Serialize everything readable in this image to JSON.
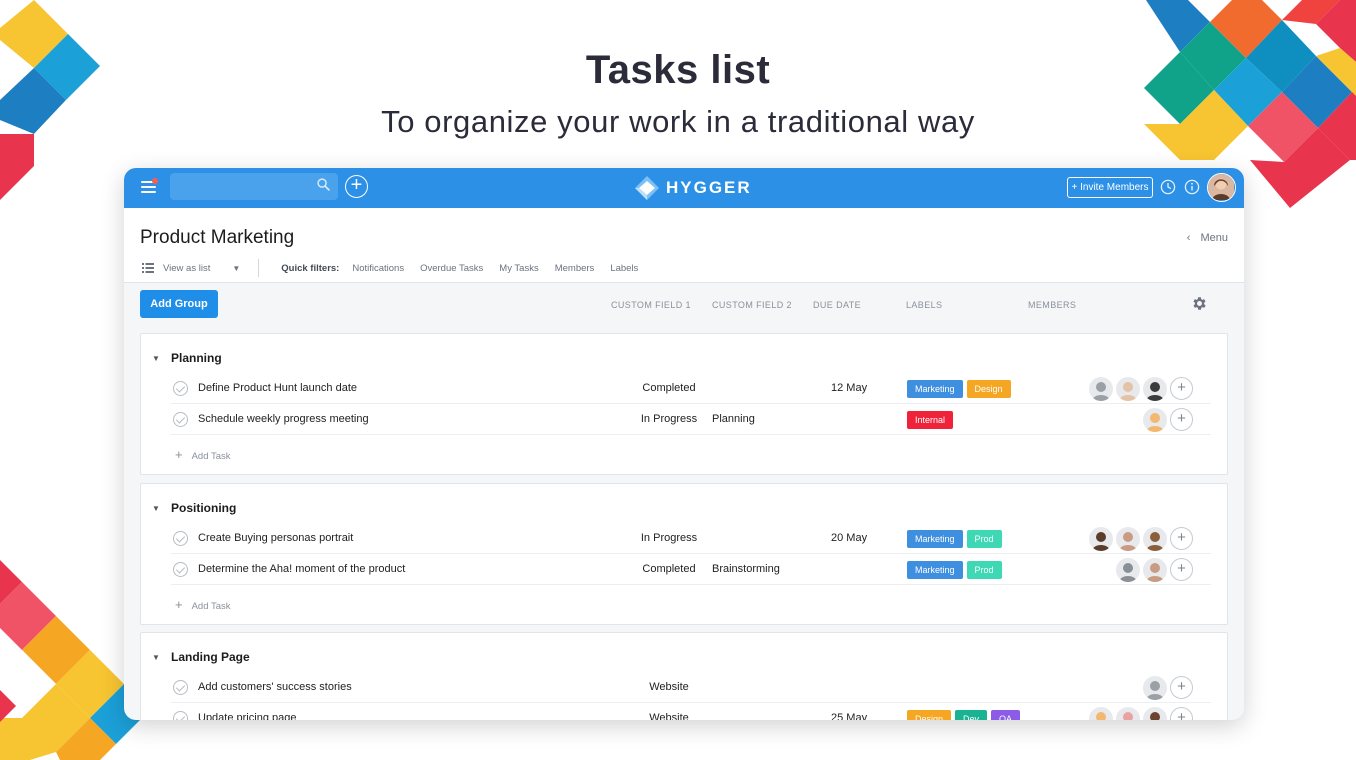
{
  "hero": {
    "title": "Tasks list",
    "subtitle": "To organize your work in a traditional way"
  },
  "topbar": {
    "logo": "HYGGER",
    "invite_label": "+ Invite Members",
    "icons": [
      "hamburger-icon",
      "search-icon",
      "plus-circle-icon",
      "clock-icon",
      "info-icon"
    ],
    "accent": "#2b90e6"
  },
  "header": {
    "title": "Product Marketing",
    "menu_label": "Menu",
    "view_label": "View as list",
    "quick_filters_label": "Quick filters:",
    "quick_filters": [
      "Notifications",
      "Overdue Tasks",
      "My Tasks",
      "Members",
      "Labels"
    ]
  },
  "toolbar": {
    "add_group_label": "Add Group",
    "columns": [
      "CUSTOM FIELD 1",
      "CUSTOM FIELD 2",
      "DUE DATE",
      "LABELS",
      "MEMBERS"
    ]
  },
  "label_colors": {
    "Marketing": "#3f8fe0",
    "Design": "#f5a623",
    "Internal": "#f0223a",
    "Prod": "#3ed9b4",
    "Dev": "#19b394",
    "QA": "#8c5ce6"
  },
  "add_task_label": "Add Task",
  "groups": [
    {
      "title": "Planning",
      "tasks": [
        {
          "name": "Define Product Hunt launch date",
          "cf1": "Completed",
          "cf2": "",
          "due": "12 May",
          "labels": [
            "Marketing",
            "Design"
          ],
          "members": 3
        },
        {
          "name": "Schedule weekly progress meeting",
          "cf1": "In Progress",
          "cf2": "Planning",
          "due": "",
          "labels": [
            "Internal"
          ],
          "members": 1
        }
      ]
    },
    {
      "title": "Positioning",
      "tasks": [
        {
          "name": "Create Buying personas portrait",
          "cf1": "In Progress",
          "cf2": "",
          "due": "20 May",
          "labels": [
            "Marketing",
            "Prod"
          ],
          "members": 3
        },
        {
          "name": "Determine the Aha! moment of the product",
          "cf1": "Completed",
          "cf2": "Brainstorming",
          "due": "",
          "labels": [
            "Marketing",
            "Prod"
          ],
          "members": 2
        }
      ]
    },
    {
      "title": "Landing Page",
      "tasks": [
        {
          "name": "Add customers' success stories",
          "cf1": "Website",
          "cf2": "",
          "due": "",
          "labels": [],
          "members": 1
        },
        {
          "name": "Update pricing page",
          "cf1": "Website",
          "cf2": "",
          "due": "25 May",
          "labels": [
            "Design",
            "Dev",
            "QA"
          ],
          "members": 3
        }
      ]
    }
  ]
}
